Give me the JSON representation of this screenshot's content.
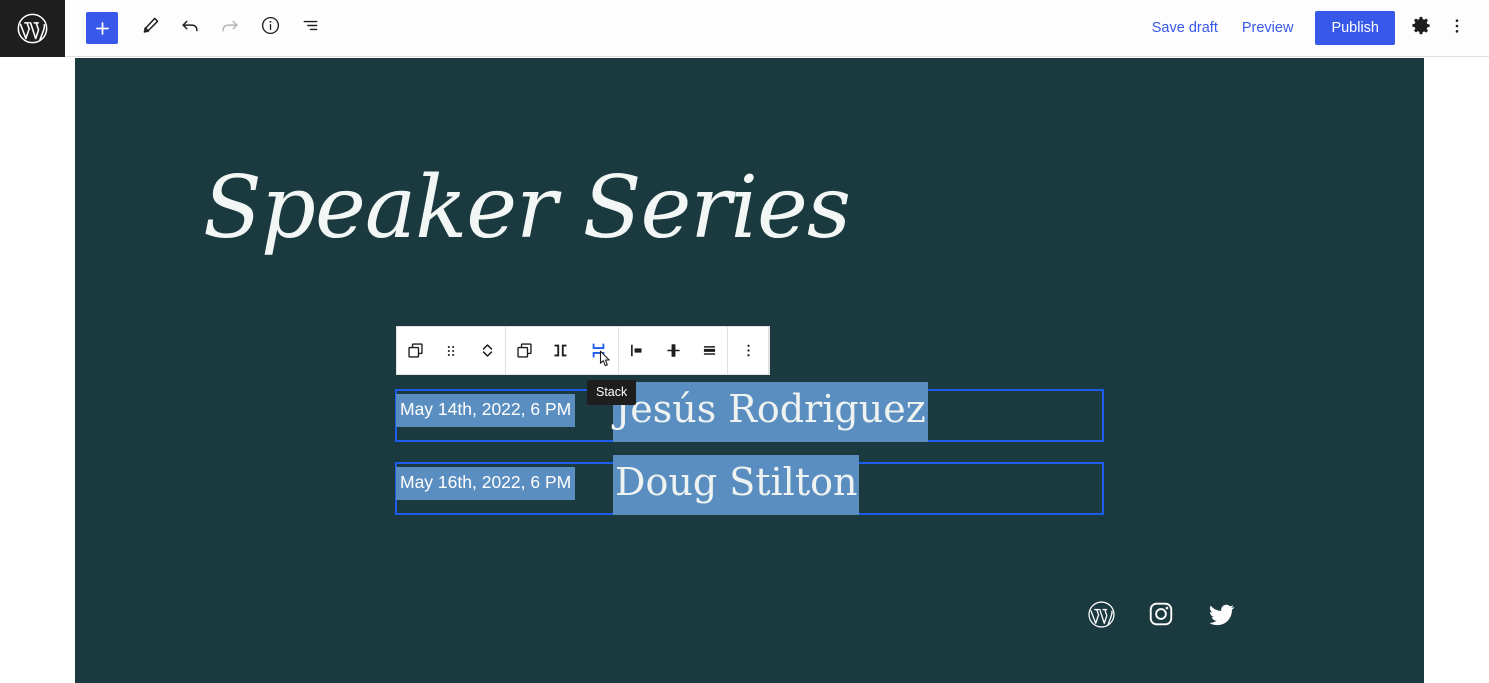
{
  "header": {
    "logo_icon": "wordpress-logo-icon",
    "left_tools": [
      {
        "name": "add-block-button",
        "icon": "plus-icon",
        "label": "Add block",
        "disabled": false
      },
      {
        "name": "tools-button",
        "icon": "pencil-icon",
        "label": "Tools",
        "disabled": false
      },
      {
        "name": "undo-button",
        "icon": "undo-arrow-icon",
        "label": "Undo",
        "disabled": false
      },
      {
        "name": "redo-button",
        "icon": "redo-arrow-icon",
        "label": "Redo",
        "disabled": true
      },
      {
        "name": "details-button",
        "icon": "info-icon",
        "label": "Details",
        "disabled": false
      },
      {
        "name": "list-view-button",
        "icon": "list-view-icon",
        "label": "List View",
        "disabled": false
      }
    ],
    "save_draft_label": "Save draft",
    "preview_label": "Preview",
    "publish_label": "Publish",
    "settings_icon": "gear-icon",
    "options_icon": "three-dots-vertical-icon",
    "accent_color": "#3858e9"
  },
  "block_toolbar": {
    "groups": [
      {
        "name": "block-group-primary",
        "buttons": [
          {
            "name": "block-type-button",
            "icon": "columns-block-icon",
            "label": "Columns",
            "active": false
          },
          {
            "name": "drag-handle",
            "icon": "drag-dots-icon",
            "label": "Drag",
            "active": false
          },
          {
            "name": "move-updown-button",
            "icon": "chevron-updown-icon",
            "label": "Move",
            "active": false
          }
        ]
      },
      {
        "name": "block-group-layout",
        "buttons": [
          {
            "name": "parent-block-button",
            "icon": "columns-block-icon",
            "label": "Select parent",
            "active": false
          },
          {
            "name": "row-layout-button",
            "icon": "row-layout-icon",
            "label": "Row",
            "active": false
          },
          {
            "name": "stack-layout-button",
            "icon": "stack-layout-icon",
            "label": "Stack",
            "active": true
          }
        ]
      },
      {
        "name": "block-group-align",
        "buttons": [
          {
            "name": "align-left-button",
            "icon": "align-left-icon",
            "label": "Align left",
            "active": false
          },
          {
            "name": "align-center-button",
            "icon": "align-center-icon",
            "label": "Align center",
            "active": false
          },
          {
            "name": "align-bottom-button",
            "icon": "align-bottom-icon",
            "label": "Align bottom",
            "active": false
          }
        ]
      },
      {
        "name": "block-group-options",
        "buttons": [
          {
            "name": "block-options-button",
            "icon": "three-dots-vertical-icon",
            "label": "Options",
            "active": false
          }
        ]
      }
    ],
    "tooltip": "Stack",
    "active_color": "#1d5ded"
  },
  "canvas": {
    "background_color": "#1a3a3f",
    "site_title": "Speaker Series",
    "selection_color": "#5b8ec0",
    "block_outline_color": "#1d5ded",
    "schedule": [
      {
        "date": "May 14th, 2022, 6 PM",
        "name": "Jesús Rodriguez"
      },
      {
        "date": "May 16th, 2022, 6 PM",
        "name": "Doug Stilton"
      }
    ],
    "social": [
      {
        "name": "social-wordpress-link",
        "icon": "wordpress-icon",
        "label": "WordPress"
      },
      {
        "name": "social-instagram-link",
        "icon": "instagram-icon",
        "label": "Instagram"
      },
      {
        "name": "social-twitter-link",
        "icon": "twitter-icon",
        "label": "Twitter"
      }
    ]
  }
}
